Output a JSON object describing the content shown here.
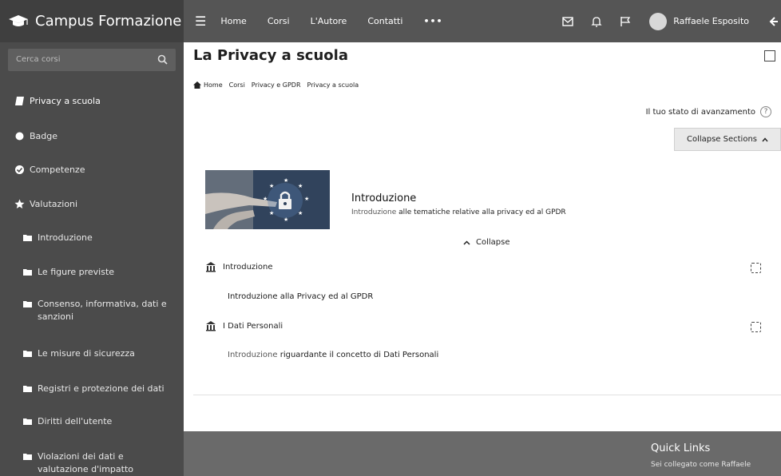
{
  "brand": {
    "name": "Campus Formazione",
    "icon": "graduation-cap-icon"
  },
  "nav": {
    "links": [
      "Home",
      "Corsi",
      "L'Autore",
      "Contatti"
    ],
    "more": "•••"
  },
  "user": {
    "name": "Raffaele Esposito"
  },
  "sidebar": {
    "search_placeholder": "Cerca corsi",
    "items": [
      {
        "label": "Privacy a scuola",
        "icon": "book-icon"
      },
      {
        "label": "Badge",
        "icon": "badge-icon"
      },
      {
        "label": "Competenze",
        "icon": "check-circle-icon"
      },
      {
        "label": "Valutazioni",
        "icon": "star-icon"
      },
      {
        "label": "Introduzione",
        "icon": "folder-icon"
      },
      {
        "label": "Le figure previste",
        "icon": "folder-icon"
      },
      {
        "label": "Consenso, informativa, dati e sanzioni",
        "icon": "folder-icon"
      },
      {
        "label": "Le misure di sicurezza",
        "icon": "folder-icon"
      },
      {
        "label": "Registri e protezione dei dati",
        "icon": "folder-icon"
      },
      {
        "label": "Diritti dell'utente",
        "icon": "folder-icon"
      },
      {
        "label": "Violazioni dei dati e valutazione d'impatto",
        "icon": "folder-icon"
      }
    ]
  },
  "page": {
    "title": "La Privacy a scuola",
    "breadcrumb": [
      "Home",
      "Corsi",
      "Privacy e GPDR",
      "Privacy a scuola"
    ],
    "progress_label": "Il tuo stato di avanzamento",
    "collapse_sections": "Collapse Sections",
    "section": {
      "title": "Introduzione",
      "desc_light": "Introduzione",
      "desc_bold": "alle tematiche relative alla privacy ed al GPDR",
      "collapse_label": "Collapse"
    },
    "activities": [
      {
        "title": "Introduzione",
        "desc_light": "",
        "desc_bold": "Introduzione alla Privacy ed al GPDR"
      },
      {
        "title": "I Dati Personali",
        "desc_light": "Introduzione",
        "desc_bold": "riguardante il concetto di  Dati Personali"
      }
    ]
  },
  "footer": {
    "title": "Quick Links",
    "text": "Sei collegato come Raffaele"
  }
}
